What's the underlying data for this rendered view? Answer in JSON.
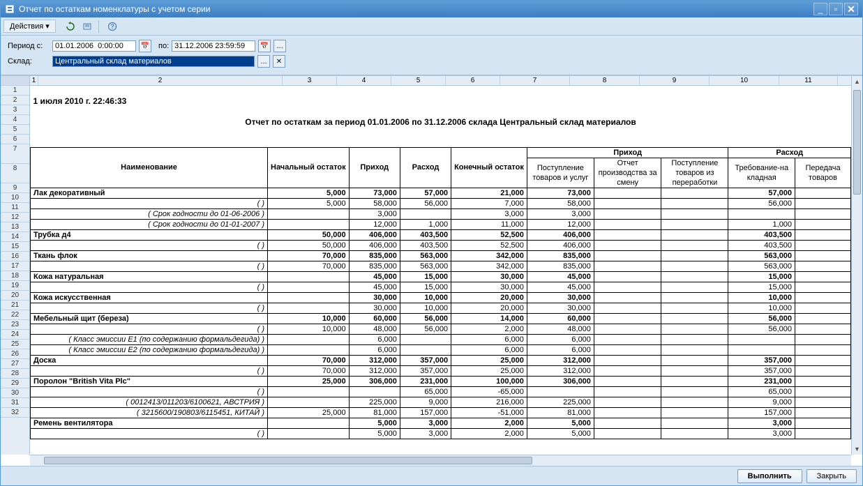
{
  "window_title": "Отчет по остаткам номенклатуры с учетом серии",
  "toolbar": {
    "actions_label": "Действия"
  },
  "filter": {
    "period_label": "Период с:",
    "period_from": "01.01.2006  0:00:00",
    "period_to_label": "по:",
    "period_to": "31.12.2006 23:59:59",
    "sklad_label": "Склад:",
    "sklad_value": "Центральный склад материалов"
  },
  "col_headers": [
    "1",
    "2",
    "3",
    "4",
    "5",
    "6",
    "7",
    "8",
    "9",
    "10",
    "11"
  ],
  "report": {
    "timestamp": "1 июля 2010 г. 22:46:33",
    "title": "Отчет по остаткам за период 01.01.2006 по 31.12.2006 склада Центральный склад материалов",
    "header_top": {
      "name": "Наименование",
      "start": "Начальный остаток",
      "in": "Приход",
      "out": "Расход",
      "end": "Конечный остаток",
      "in_group": "Приход",
      "out_group": "Расход"
    },
    "header_sub": {
      "in1": "Поступление товаров и услуг",
      "in2": "Отчет производства за смену",
      "in3": "Поступление товаров из переработки",
      "out1": "Требование-на кладная",
      "out2": "Передача товаров"
    },
    "rows": [
      {
        "type": "main",
        "name": "Лак декоративный",
        "start": "5,000",
        "in": "73,000",
        "out": "57,000",
        "end": "21,000",
        "in1": "73,000",
        "in2": "",
        "in3": "",
        "out1": "57,000",
        "out2": ""
      },
      {
        "type": "sub",
        "name": "( )",
        "start": "5,000",
        "in": "58,000",
        "out": "56,000",
        "end": "7,000",
        "in1": "58,000",
        "in2": "",
        "in3": "",
        "out1": "56,000",
        "out2": ""
      },
      {
        "type": "sub",
        "name": "( Срок годности до 01-06-2006 )",
        "start": "",
        "in": "3,000",
        "out": "",
        "end": "3,000",
        "in1": "3,000",
        "in2": "",
        "in3": "",
        "out1": "",
        "out2": ""
      },
      {
        "type": "sub",
        "name": "( Срок годности до 01-01-2007 )",
        "start": "",
        "in": "12,000",
        "out": "1,000",
        "end": "11,000",
        "in1": "12,000",
        "in2": "",
        "in3": "",
        "out1": "1,000",
        "out2": ""
      },
      {
        "type": "main",
        "name": "Трубка д4",
        "start": "50,000",
        "in": "406,000",
        "out": "403,500",
        "end": "52,500",
        "in1": "406,000",
        "in2": "",
        "in3": "",
        "out1": "403,500",
        "out2": ""
      },
      {
        "type": "sub",
        "name": "( )",
        "start": "50,000",
        "in": "406,000",
        "out": "403,500",
        "end": "52,500",
        "in1": "406,000",
        "in2": "",
        "in3": "",
        "out1": "403,500",
        "out2": ""
      },
      {
        "type": "main",
        "name": "Ткань флок",
        "start": "70,000",
        "in": "835,000",
        "out": "563,000",
        "end": "342,000",
        "in1": "835,000",
        "in2": "",
        "in3": "",
        "out1": "563,000",
        "out2": ""
      },
      {
        "type": "sub",
        "name": "( )",
        "start": "70,000",
        "in": "835,000",
        "out": "563,000",
        "end": "342,000",
        "in1": "835,000",
        "in2": "",
        "in3": "",
        "out1": "563,000",
        "out2": ""
      },
      {
        "type": "main",
        "name": "Кожа натуральная",
        "start": "",
        "in": "45,000",
        "out": "15,000",
        "end": "30,000",
        "in1": "45,000",
        "in2": "",
        "in3": "",
        "out1": "15,000",
        "out2": ""
      },
      {
        "type": "sub",
        "name": "( )",
        "start": "",
        "in": "45,000",
        "out": "15,000",
        "end": "30,000",
        "in1": "45,000",
        "in2": "",
        "in3": "",
        "out1": "15,000",
        "out2": ""
      },
      {
        "type": "main",
        "name": "Кожа искусственная",
        "start": "",
        "in": "30,000",
        "out": "10,000",
        "end": "20,000",
        "in1": "30,000",
        "in2": "",
        "in3": "",
        "out1": "10,000",
        "out2": ""
      },
      {
        "type": "sub",
        "name": "( )",
        "start": "",
        "in": "30,000",
        "out": "10,000",
        "end": "20,000",
        "in1": "30,000",
        "in2": "",
        "in3": "",
        "out1": "10,000",
        "out2": ""
      },
      {
        "type": "main",
        "name": "Мебельный щит (береза)",
        "start": "10,000",
        "in": "60,000",
        "out": "56,000",
        "end": "14,000",
        "in1": "60,000",
        "in2": "",
        "in3": "",
        "out1": "56,000",
        "out2": ""
      },
      {
        "type": "sub",
        "name": "( )",
        "start": "10,000",
        "in": "48,000",
        "out": "56,000",
        "end": "2,000",
        "in1": "48,000",
        "in2": "",
        "in3": "",
        "out1": "56,000",
        "out2": ""
      },
      {
        "type": "sub",
        "name": "( Класс эмиссии Е1 (по содержанию формальдегида) )",
        "start": "",
        "in": "6,000",
        "out": "",
        "end": "6,000",
        "in1": "6,000",
        "in2": "",
        "in3": "",
        "out1": "",
        "out2": ""
      },
      {
        "type": "sub",
        "name": "( Класс эмиссии Е2 (по содержанию формальдегида) )",
        "start": "",
        "in": "6,000",
        "out": "",
        "end": "6,000",
        "in1": "6,000",
        "in2": "",
        "in3": "",
        "out1": "",
        "out2": ""
      },
      {
        "type": "main",
        "name": "Доска",
        "start": "70,000",
        "in": "312,000",
        "out": "357,000",
        "end": "25,000",
        "in1": "312,000",
        "in2": "",
        "in3": "",
        "out1": "357,000",
        "out2": ""
      },
      {
        "type": "sub",
        "name": "( )",
        "start": "70,000",
        "in": "312,000",
        "out": "357,000",
        "end": "25,000",
        "in1": "312,000",
        "in2": "",
        "in3": "",
        "out1": "357,000",
        "out2": ""
      },
      {
        "type": "main",
        "name": "Поролон \"British Vita Plc\"",
        "start": "25,000",
        "in": "306,000",
        "out": "231,000",
        "end": "100,000",
        "in1": "306,000",
        "in2": "",
        "in3": "",
        "out1": "231,000",
        "out2": ""
      },
      {
        "type": "sub",
        "name": "( )",
        "start": "",
        "in": "",
        "out": "65,000",
        "end": "-65,000",
        "in1": "",
        "in2": "",
        "in3": "",
        "out1": "65,000",
        "out2": ""
      },
      {
        "type": "sub",
        "name": "( 0012413/011203/6100621, АВСТРИЯ )",
        "start": "",
        "in": "225,000",
        "out": "9,000",
        "end": "216,000",
        "in1": "225,000",
        "in2": "",
        "in3": "",
        "out1": "9,000",
        "out2": ""
      },
      {
        "type": "sub",
        "name": "( 3215600/190803/6115451, КИТАЙ )",
        "start": "25,000",
        "in": "81,000",
        "out": "157,000",
        "end": "-51,000",
        "in1": "81,000",
        "in2": "",
        "in3": "",
        "out1": "157,000",
        "out2": ""
      },
      {
        "type": "main",
        "name": "Ремень вентилятора",
        "start": "",
        "in": "5,000",
        "out": "3,000",
        "end": "2,000",
        "in1": "5,000",
        "in2": "",
        "in3": "",
        "out1": "3,000",
        "out2": ""
      },
      {
        "type": "sub",
        "name": "( )",
        "start": "",
        "in": "5,000",
        "out": "3,000",
        "end": "2,000",
        "in1": "5,000",
        "in2": "",
        "in3": "",
        "out1": "3,000",
        "out2": ""
      }
    ]
  },
  "footer": {
    "execute": "Выполнить",
    "close": "Закрыть"
  }
}
